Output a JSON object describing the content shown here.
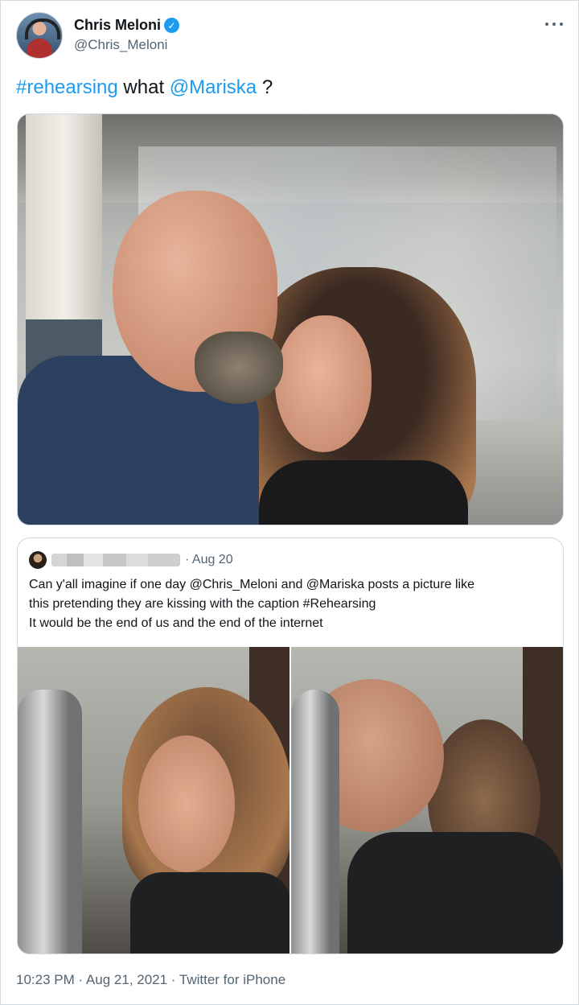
{
  "author": {
    "display_name": "Chris Meloni",
    "handle": "@Chris_Meloni",
    "verified": true
  },
  "tweet": {
    "hashtag": "#rehearsing",
    "text_middle": " what ",
    "mention": "@Mariska",
    "text_end": " ?"
  },
  "quoted_tweet": {
    "date": "· Aug 20",
    "lines": [
      "Can y'all  imagine if one day @Chris_Meloni and @Mariska  posts a picture like",
      "this pretending they are kissing with the caption #Rehearsing",
      "It would be the end of us and the end of the internet"
    ]
  },
  "footer": {
    "timestamp": "10:23 PM · Aug 21, 2021 · Twitter for iPhone"
  },
  "colors": {
    "link": "#1d9bf0",
    "secondary_text": "#536471",
    "border": "#cfd9de"
  }
}
